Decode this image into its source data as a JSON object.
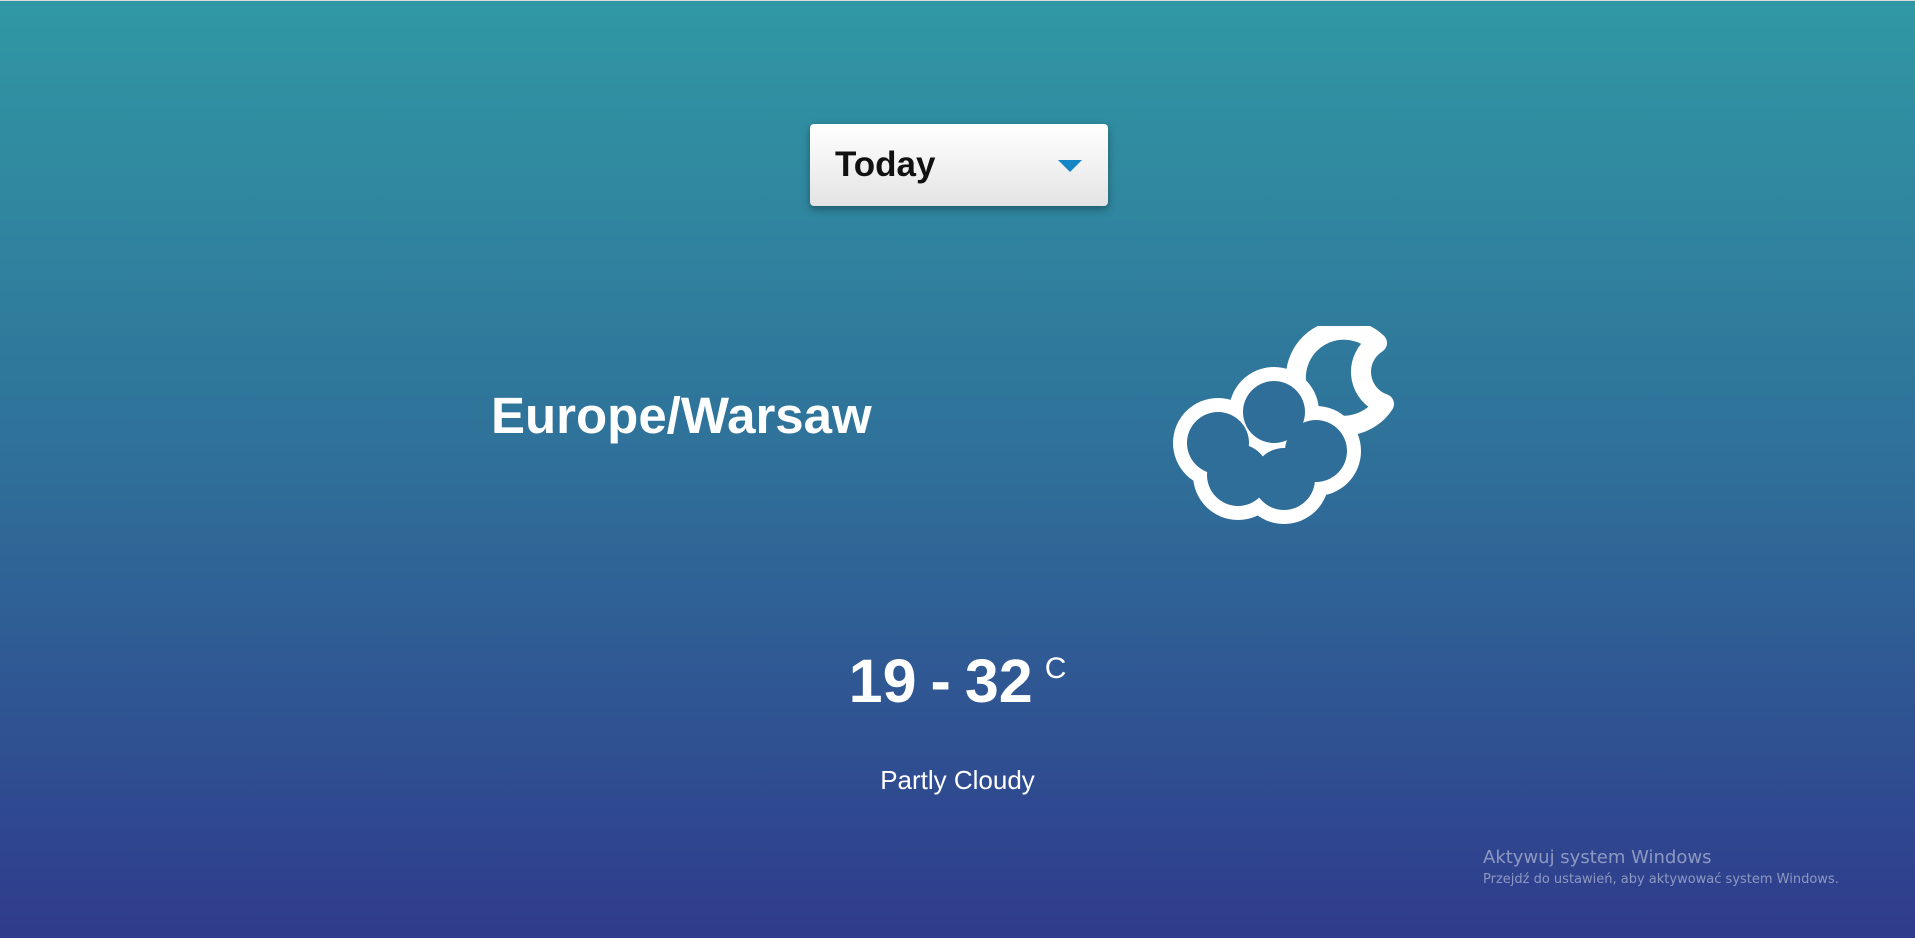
{
  "day_select": {
    "selected": "Today",
    "caret_color": "#1585c4"
  },
  "location": "Europe/Warsaw",
  "weather": {
    "icon": "partly-cloudy-night-icon",
    "temp_min": "19",
    "separator": "-",
    "temp_max": "32",
    "unit": "C",
    "condition": "Partly Cloudy"
  },
  "watermark": {
    "title": "Aktywuj system Windows",
    "subtitle": "Przejdź do ustawień, aby aktywować system Windows."
  },
  "colors": {
    "background_top": "#3098a4",
    "background_bottom": "#2f3b8c",
    "text": "#ffffff"
  }
}
